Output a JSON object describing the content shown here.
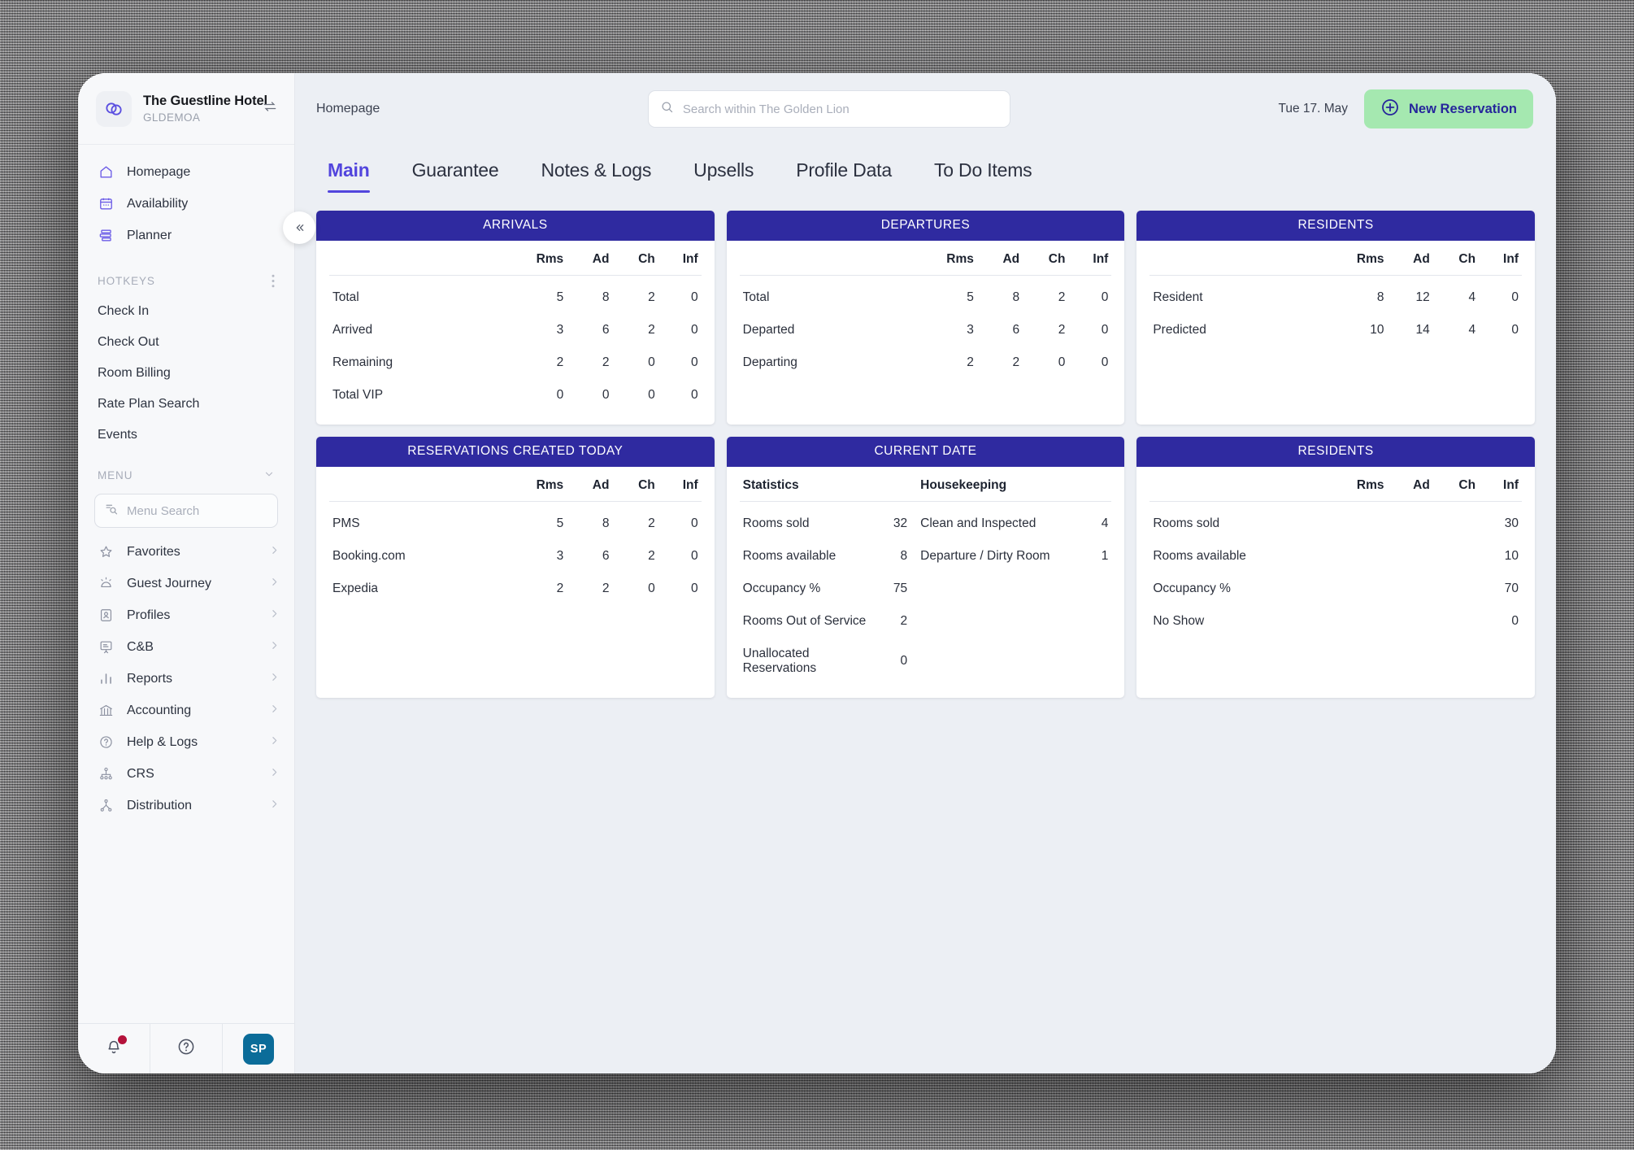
{
  "sidebar": {
    "hotel": {
      "name": "The Guestline Hotel",
      "code": "GLDEMOA",
      "swap_icon": "swap-icon",
      "logo_icon": "guestline-logo-icon"
    },
    "collapse_icon": "chevron-double-left-icon",
    "nav": [
      {
        "label": "Homepage",
        "icon": "home-icon"
      },
      {
        "label": "Availability",
        "icon": "calendar-icon"
      },
      {
        "label": "Planner",
        "icon": "planner-icon"
      }
    ],
    "hotkeys_header": "HOTKEYS",
    "hotkeys_more_icon": "more-vertical-icon",
    "hotkeys": [
      "Check In",
      "Check Out",
      "Room Billing",
      "Rate Plan Search",
      "Events"
    ],
    "menu_header": "MENU",
    "menu_collapse_icon": "chevron-down-icon",
    "menu_search": {
      "placeholder": "Menu Search",
      "value": "",
      "icon": "menu-search-icon"
    },
    "menu": [
      {
        "label": "Favorites",
        "icon": "star-icon"
      },
      {
        "label": "Guest Journey",
        "icon": "guest-journey-icon"
      },
      {
        "label": "Profiles",
        "icon": "profile-icon"
      },
      {
        "label": "C&B",
        "icon": "presentation-icon"
      },
      {
        "label": "Reports",
        "icon": "bar-chart-icon"
      },
      {
        "label": "Accounting",
        "icon": "bank-icon"
      },
      {
        "label": "Help & Logs",
        "icon": "question-circle-icon"
      },
      {
        "label": "CRS",
        "icon": "crs-network-icon"
      },
      {
        "label": "Distribution",
        "icon": "distribution-icon"
      }
    ],
    "footer": {
      "notifications_icon": "bell-icon",
      "help_icon": "question-circle-icon",
      "avatar_initials": "SP"
    }
  },
  "topbar": {
    "breadcrumb": "Homepage",
    "search": {
      "placeholder": "Search within The Golden Lion",
      "value": "",
      "icon": "search-icon"
    },
    "date": "Tue 17. May",
    "new_reservation": {
      "label": "New Reservation",
      "icon": "plus-circle-icon"
    }
  },
  "tabs": [
    {
      "label": "Main",
      "active": true
    },
    {
      "label": "Guarantee",
      "active": false
    },
    {
      "label": "Notes & Logs",
      "active": false
    },
    {
      "label": "Upsells",
      "active": false
    },
    {
      "label": "Profile Data",
      "active": false
    },
    {
      "label": "To Do Items",
      "active": false
    }
  ],
  "colors": {
    "card_header": "#2f2aa0",
    "accent": "#5245dd",
    "new_reservation_bg": "#a5e8b0",
    "new_reservation_text": "#26269b",
    "avatar_bg": "#0b6c99",
    "notification_dot": "#b4123b"
  },
  "cards": [
    {
      "title": "ARRIVALS",
      "columns": [
        "",
        "Rms",
        "Ad",
        "Ch",
        "Inf"
      ],
      "rows": [
        [
          "Total",
          "5",
          "8",
          "2",
          "0"
        ],
        [
          "Arrived",
          "3",
          "6",
          "2",
          "0"
        ],
        [
          "Remaining",
          "2",
          "2",
          "0",
          "0"
        ],
        [
          "Total VIP",
          "0",
          "0",
          "0",
          "0"
        ]
      ]
    },
    {
      "title": "DEPARTURES",
      "columns": [
        "",
        "Rms",
        "Ad",
        "Ch",
        "Inf"
      ],
      "rows": [
        [
          "Total",
          "5",
          "8",
          "2",
          "0"
        ],
        [
          "Departed",
          "3",
          "6",
          "2",
          "0"
        ],
        [
          "Departing",
          "2",
          "2",
          "0",
          "0"
        ]
      ]
    },
    {
      "title": "RESIDENTS",
      "columns": [
        "",
        "Rms",
        "Ad",
        "Ch",
        "Inf"
      ],
      "rows": [
        [
          "Resident",
          "8",
          "12",
          "4",
          "0"
        ],
        [
          "Predicted",
          "10",
          "14",
          "4",
          "0"
        ]
      ]
    },
    {
      "title": "RESERVATIONS CREATED TODAY",
      "columns": [
        "",
        "Rms",
        "Ad",
        "Ch",
        "Inf"
      ],
      "rows": [
        [
          "PMS",
          "5",
          "8",
          "2",
          "0"
        ],
        [
          "Booking.com",
          "3",
          "6",
          "2",
          "0"
        ],
        [
          "Expedia",
          "2",
          "2",
          "0",
          "0"
        ]
      ]
    },
    {
      "title": "CURRENT DATE",
      "columns": [
        "Statistics",
        "",
        "Housekeeping",
        ""
      ],
      "rows": [
        [
          "Rooms sold",
          "32",
          "Clean and Inspected",
          "4"
        ],
        [
          "Rooms available",
          "8",
          "Departure / Dirty Room",
          "1"
        ],
        [
          "Occupancy %",
          "75",
          "",
          ""
        ],
        [
          "Rooms Out of Service",
          "2",
          "",
          ""
        ],
        [
          "Unallocated Reservations",
          "0",
          "",
          ""
        ]
      ]
    },
    {
      "title": "RESIDENTS",
      "columns": [
        "",
        "Rms",
        "Ad",
        "Ch",
        "Inf"
      ],
      "rows": [
        [
          "Rooms sold",
          "",
          "",
          "",
          "30"
        ],
        [
          "Rooms available",
          "",
          "",
          "",
          "10"
        ],
        [
          "Occupancy %",
          "",
          "",
          "",
          "70"
        ],
        [
          "No Show",
          "",
          "",
          "",
          "0"
        ]
      ]
    }
  ]
}
